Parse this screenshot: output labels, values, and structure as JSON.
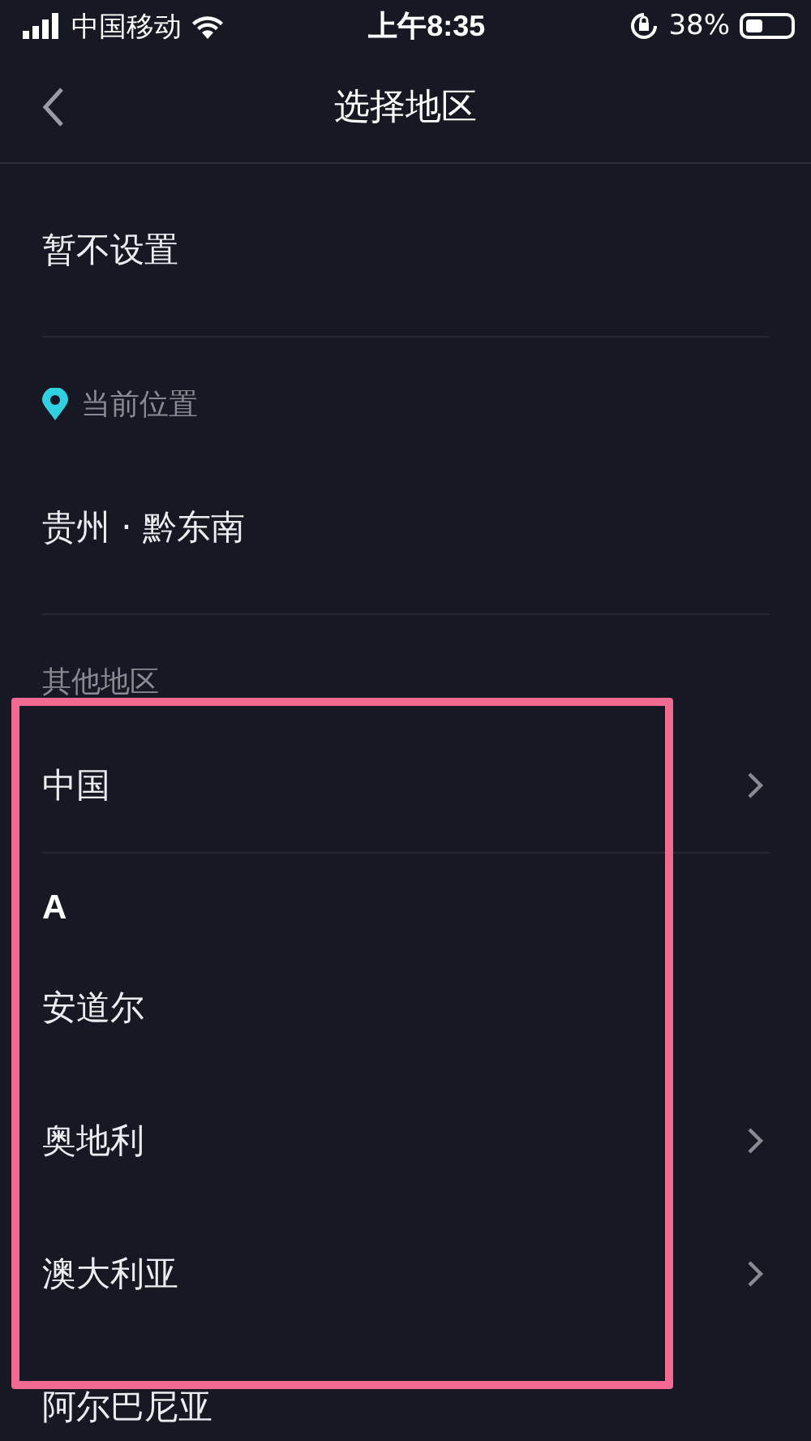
{
  "status_bar": {
    "carrier": "中国移动",
    "time": "上午8:35",
    "battery": "38%"
  },
  "nav": {
    "title": "选择地区"
  },
  "sections": [
    {
      "kind": "option",
      "label": "暂不设置"
    },
    {
      "kind": "location_header",
      "label": "当前位置"
    },
    {
      "kind": "option",
      "label": "贵州 · 黔东南"
    },
    {
      "kind": "header",
      "label": "其他地区"
    },
    {
      "kind": "region",
      "label": "中国",
      "has_children": true
    },
    {
      "kind": "letter",
      "label": "A"
    },
    {
      "kind": "region",
      "label": "安道尔",
      "has_children": false
    },
    {
      "kind": "region",
      "label": "奥地利",
      "has_children": true
    },
    {
      "kind": "region",
      "label": "澳大利亚",
      "has_children": true
    },
    {
      "kind": "region",
      "label": "阿尔巴尼亚",
      "has_children": false
    }
  ],
  "annotation": {
    "kind": "frame",
    "color": "#f06a92"
  }
}
